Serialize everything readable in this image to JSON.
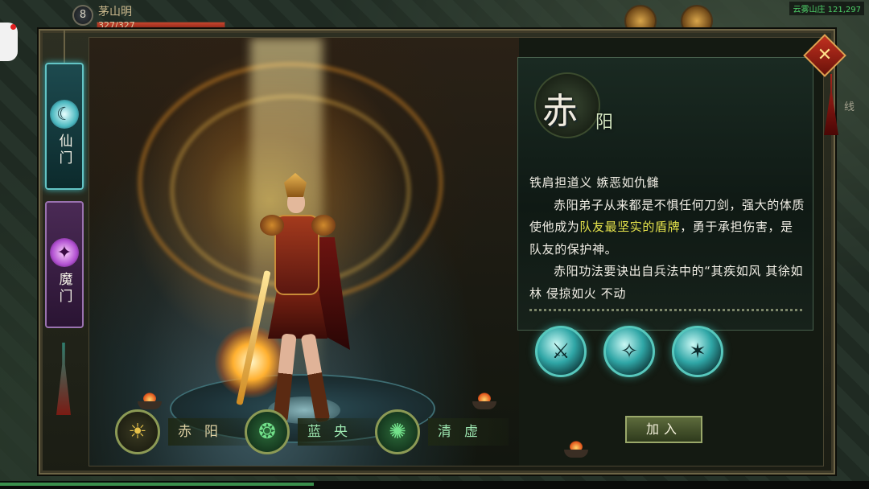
{
  "hud": {
    "level": "8",
    "player_name": "茅山明",
    "hp_text": "327/327",
    "hp_fraction": 1.0,
    "coords": "云雾山庄 121,297",
    "right_strip_text": "线"
  },
  "side_tabs": {
    "xian_label": "仙门",
    "mo_label": "魔门"
  },
  "info": {
    "name_big": "赤",
    "name_small": "阳",
    "motto": "铁肩担道义 嫉恶如仇雠",
    "para1_a": "赤阳弟子从来都是不惧任何刀剑，强大的体质使他成为",
    "para1_hl": "队友最坚实的盾牌",
    "para1_b": "，勇于承担伤害，是队友的保护神。",
    "para2": "赤阳功法要诀出自兵法中的“其疾如风 其徐如林 侵掠如火 不动"
  },
  "skills": [
    "skill-1",
    "skill-2",
    "skill-3"
  ],
  "join_label": "加入",
  "factions": [
    {
      "name": "赤阳"
    },
    {
      "name": "蓝央"
    },
    {
      "name": "清虚"
    }
  ],
  "close_label": "✕",
  "colors": {
    "highlight": "#e6e34c",
    "xian_accent": "#63c4c5",
    "mo_accent": "#9a72b0",
    "skill_accent": "#57c8bd"
  }
}
